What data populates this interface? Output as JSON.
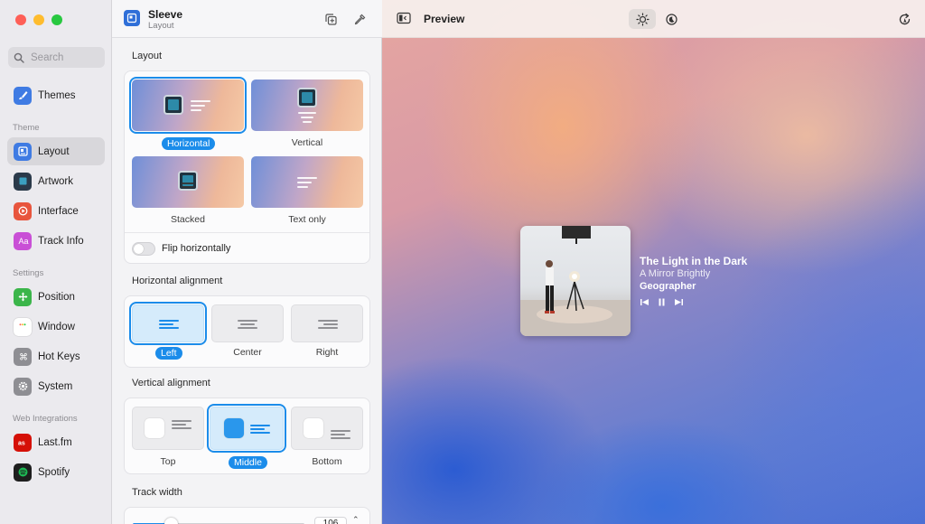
{
  "sidebar": {
    "search_placeholder": "Search",
    "items": [
      {
        "id": "themes",
        "label": "Themes",
        "icon": "paintbrush-icon",
        "color": "#3f7be3"
      },
      {
        "id": "layout",
        "label": "Layout",
        "icon": "layout-icon",
        "color": "#3f7be3",
        "active": true
      },
      {
        "id": "artwork",
        "label": "Artwork",
        "icon": "artwork-icon",
        "color": "#2b3a4a"
      },
      {
        "id": "interface",
        "label": "Interface",
        "icon": "interface-icon",
        "color": "#e8553d"
      },
      {
        "id": "trackinfo",
        "label": "Track Info",
        "icon": "text-format-icon",
        "color": "#c94fd6"
      },
      {
        "id": "position",
        "label": "Position",
        "icon": "move-arrows-icon",
        "color": "#3bb54a"
      },
      {
        "id": "window",
        "label": "Window",
        "icon": "window-icon",
        "color": "#ffffff"
      },
      {
        "id": "hotkeys",
        "label": "Hot Keys",
        "icon": "command-icon",
        "color": "#8e8e93"
      },
      {
        "id": "system",
        "label": "System",
        "icon": "gear-icon",
        "color": "#8e8e93"
      },
      {
        "id": "lastfm",
        "label": "Last.fm",
        "icon": "lastfm-icon",
        "color": "#d51007"
      },
      {
        "id": "spotify",
        "label": "Spotify",
        "icon": "spotify-icon",
        "color": "#1db954"
      }
    ],
    "sections": {
      "theme": "Theme",
      "settings": "Settings",
      "web": "Web Integrations"
    }
  },
  "panel": {
    "app_name": "Sleeve",
    "app_subtitle": "Layout",
    "layout_title": "Layout",
    "layout_options": [
      "Horizontal",
      "Vertical",
      "Stacked",
      "Text only"
    ],
    "layout_selected": "Horizontal",
    "flip_label": "Flip horizontally",
    "flip_on": false,
    "halign_title": "Horizontal alignment",
    "halign_options": [
      "Left",
      "Center",
      "Right"
    ],
    "halign_selected": "Left",
    "valign_title": "Vertical alignment",
    "valign_options": [
      "Top",
      "Middle",
      "Bottom"
    ],
    "valign_selected": "Middle",
    "width_title": "Track width",
    "width_value": "106"
  },
  "preview": {
    "title": "Preview",
    "mode": "light",
    "track": {
      "title": "The Light in the Dark",
      "album": "A Mirror Brightly",
      "artist": "Geographer"
    }
  },
  "colors": {
    "accent": "#1b8cea"
  }
}
